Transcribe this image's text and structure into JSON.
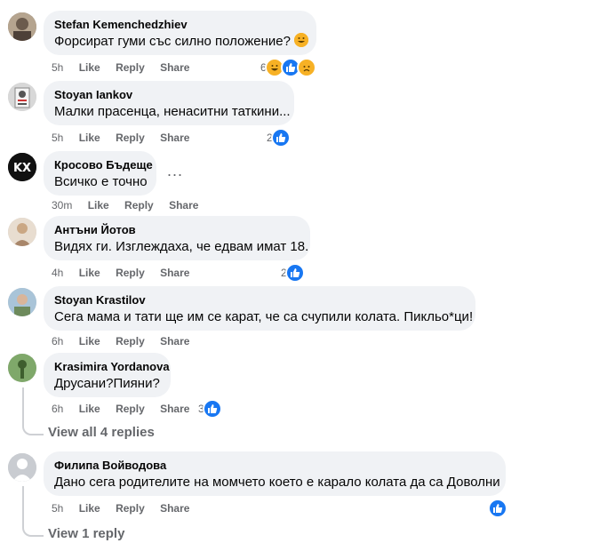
{
  "comments": [
    {
      "author": "Stefan Kemenchedzhiev",
      "text": "Форсират гуми със силно положение?",
      "time": "5h",
      "reaction_count": "6"
    },
    {
      "author": "Stoyan Iankov",
      "text": "Малки прасенца, ненаситни таткини...",
      "time": "5h",
      "reaction_count": "2"
    },
    {
      "author": "Кросово Бъдеще",
      "text": "Всичко е точно",
      "time": "30m",
      "reaction_count": ""
    },
    {
      "author": "Антъни Йотов",
      "text": "Видях ги. Изглеждаха, че едвам имат 18.",
      "time": "4h",
      "reaction_count": "2"
    },
    {
      "author": "Stoyan Krastilov",
      "text": "Сега мама и тати ще им се карат, че са счупили колата. Пикльо*ци!",
      "time": "6h",
      "reaction_count": ""
    },
    {
      "author": "Krasimira Yordanova",
      "text": "Друсани?Пияни?",
      "time": "6h",
      "reaction_count": "3"
    },
    {
      "author": "Филипа Войводова",
      "text": "Дано сега родителите на момчето което е карало колата да са Доволни",
      "time": "5h",
      "reaction_count": ""
    }
  ],
  "actions": {
    "like": "Like",
    "reply": "Reply",
    "share": "Share"
  },
  "view_replies_1": "View all 4 replies",
  "view_replies_2": "View 1 reply",
  "more_options": "...",
  "colors": {
    "like_blue": "#1877f2",
    "bubble": "#f0f2f5",
    "meta": "#65676b"
  }
}
